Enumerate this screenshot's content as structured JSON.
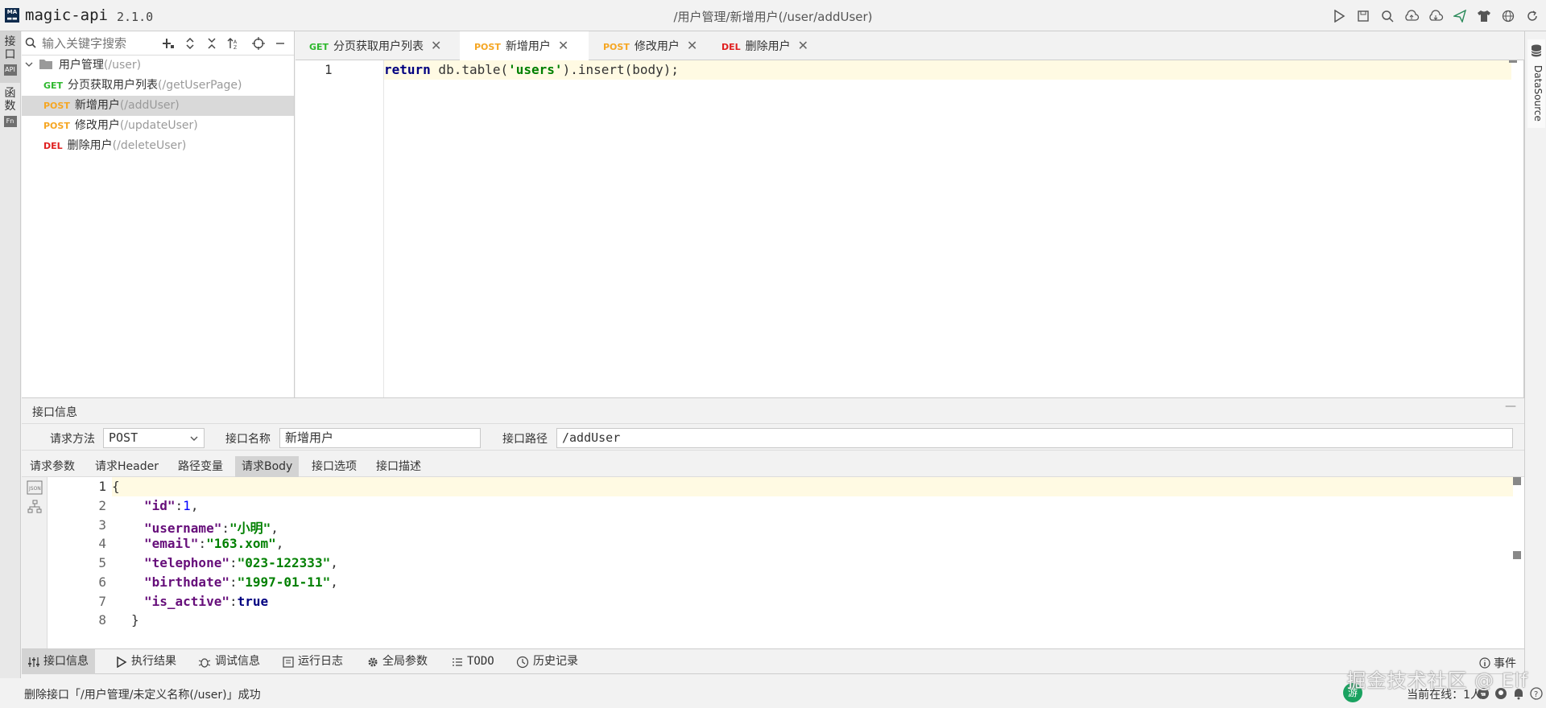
{
  "app": {
    "name": "magic-api",
    "version": "2.1.0",
    "window_title": "/用户管理/新增用户(/user/addUser)"
  },
  "toolbar_icons": [
    "run-icon",
    "save-icon",
    "search-icon",
    "upload-icon",
    "download-icon",
    "send-icon",
    "shirt-icon",
    "globe-icon",
    "refresh-icon"
  ],
  "left_rail": {
    "tab_api": "接口",
    "tab_func": "函数",
    "api_icon": "API",
    "func_icon": "Fn"
  },
  "right_rail": {
    "label": "DataSource"
  },
  "sidebar": {
    "search_placeholder": "输入关键字搜索",
    "group": {
      "name": "用户管理",
      "path": "(/user)"
    },
    "items": [
      {
        "method": "GET",
        "name": "分页获取用户列表",
        "path": "(/getUserPage)"
      },
      {
        "method": "POST",
        "name": "新增用户",
        "path": "(/addUser)"
      },
      {
        "method": "POST",
        "name": "修改用户",
        "path": "(/updateUser)"
      },
      {
        "method": "DEL",
        "name": "删除用户",
        "path": "(/deleteUser)"
      }
    ]
  },
  "tabs": [
    {
      "method": "GET",
      "name": "分页获取用户列表"
    },
    {
      "method": "POST",
      "name": "新增用户"
    },
    {
      "method": "POST",
      "name": "修改用户"
    },
    {
      "method": "DEL",
      "name": "删除用户"
    }
  ],
  "editor": {
    "line_numbers": [
      "1"
    ],
    "code": {
      "kw": "return",
      "pre": " db.table(",
      "str": "'users'",
      "post": ").insert(body);"
    }
  },
  "info_panel": {
    "title": "接口信息",
    "method_label": "请求方法",
    "method_value": "POST",
    "name_label": "接口名称",
    "name_value": "新增用户",
    "path_label": "接口路径",
    "path_value": "/addUser",
    "subtabs": [
      "请求参数",
      "请求Header",
      "路径变量",
      "请求Body",
      "接口选项",
      "接口描述"
    ],
    "body_lines": [
      "1",
      "2",
      "3",
      "4",
      "5",
      "6",
      "7",
      "8"
    ],
    "body": {
      "open": "{",
      "close": "}",
      "fields": [
        {
          "key": "\"id\"",
          "value": "1",
          "type": "num",
          "sep": ","
        },
        {
          "key": "\"username\"",
          "value": "\"小明\"",
          "type": "str",
          "sep": ","
        },
        {
          "key": "\"email\"",
          "value": "\"163.xom\"",
          "type": "str",
          "sep": ","
        },
        {
          "key": "\"telephone\"",
          "value": "\"023-122333\"",
          "type": "str",
          "sep": ","
        },
        {
          "key": "\"birthdate\"",
          "value": "\"1997-01-11\"",
          "type": "str",
          "sep": ","
        },
        {
          "key": "\"is_active\"",
          "value": "true",
          "type": "bool",
          "sep": ""
        }
      ]
    }
  },
  "bottom_toolbar": {
    "items": [
      "接口信息",
      "执行结果",
      "调试信息",
      "运行日志",
      "全局参数",
      "TODO",
      "历史记录"
    ],
    "events": "事件"
  },
  "status": {
    "message": "删除接口「/用户管理/未定义名称(/user)」成功",
    "online": "当前在线：1人",
    "game_icon": "游",
    "watermark": "掘金技术社区 @ Elf"
  },
  "colors": {
    "get": "#2eb82e",
    "post": "#f5a623",
    "del": "#e02020",
    "current_line": "#fffae3"
  }
}
